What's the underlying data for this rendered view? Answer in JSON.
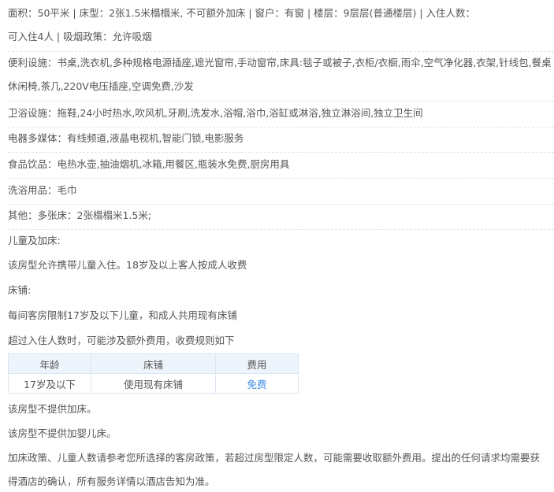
{
  "room_info": {
    "line1": "面积：50平米 | 床型：2张1.5米榻榻米, 不可额外加床 | 窗户：有窗 | 楼层：9层层(普通楼层) | 入住人数：",
    "line2": "可入住4人 | 吸烟政策：允许吸烟"
  },
  "facilities": {
    "convenience_line1": "便利设施：书桌,洗衣机,多种规格电源插座,遮光窗帘,手动窗帘,床具:毯子或被子,衣柜/衣橱,雨伞,空气净化器,衣架,针线包,餐桌,",
    "convenience_line2": "休闲椅,茶几,220V电压插座,空调免费,沙发",
    "bathroom": "卫浴设施：拖鞋,24小时热水,吹风机,牙刷,洗发水,浴帽,浴巾,浴缸或淋浴,独立淋浴间,独立卫生间",
    "media": "电器多媒体：有线频道,液晶电视机,智能门锁,电影服务",
    "food": "食品饮品：电热水壶,抽油烟机,冰箱,用餐区,瓶装水免费,厨房用具",
    "toiletries": "洗浴用品：毛巾",
    "other": "其他：多张床：2张榻榻米1.5米;"
  },
  "children_policy": {
    "heading": "儿童及加床:",
    "text": "该房型允许携带儿童入住。18岁及以上客人按成人收费"
  },
  "bedding": {
    "heading": "床铺:",
    "text1": "每间客房限制17岁及以下儿童，和成人共用现有床铺",
    "text2": "超过入住人数时，可能涉及额外费用，收费规则如下"
  },
  "fee_table": {
    "headers": [
      "年龄",
      "床铺",
      "费用"
    ],
    "rows": [
      [
        "17岁及以下",
        "使用现有床铺",
        "免费"
      ]
    ],
    "free_color": "#3a8ee6"
  },
  "notes": {
    "no_extra_bed": "该房型不提供加床。",
    "no_crib": "该房型不提供加婴儿床。",
    "disclaimer_line1": "加床政策、儿童人数请参考您所选择的客房政策，若超过房型限定人数，可能需要收取额外费用。提出的任何请求均需要获",
    "disclaimer_line2": "得酒店的确认，所有服务详情以酒店告知为准。"
  }
}
